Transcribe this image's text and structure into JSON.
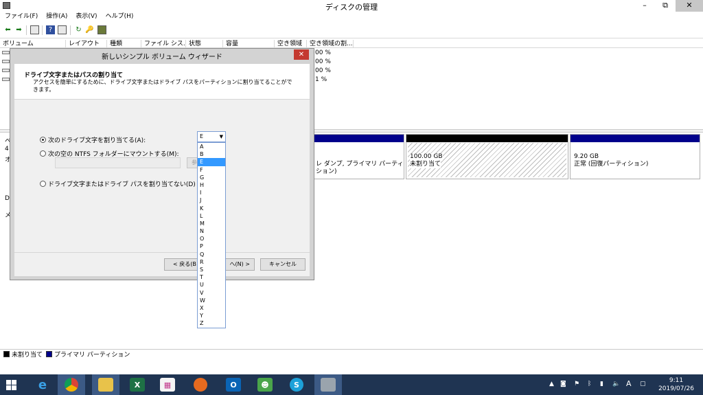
{
  "window": {
    "title": "ディスクの管理",
    "minimize": "–",
    "restore": "⧉",
    "close": "✕"
  },
  "menu": [
    "ファイル(F)",
    "操作(A)",
    "表示(V)",
    "ヘルプ(H)"
  ],
  "toolbar": {
    "icons": [
      "back-arrow-icon",
      "forward-arrow-icon",
      "properties-icon",
      "help-icon",
      "view-icon",
      "refresh-icon",
      "key-icon",
      "disk-icon"
    ]
  },
  "volume_table": {
    "headers": [
      "ボリューム",
      "レイアウト",
      "種類",
      "ファイル シス...",
      "状態",
      "容量",
      "空き領域",
      "空き領域の割..."
    ],
    "visible_cells": [
      "00 %",
      "00 %",
      "00 %",
      "1 %"
    ]
  },
  "disk_panel": {
    "left_labels": [
      "ベ",
      "4",
      "オ",
      "D",
      "メ"
    ],
    "partition_text": "レ ダンプ, プライマリ パーティション)",
    "unallocated": {
      "size": "100.00 GB",
      "status": "未割り当て"
    },
    "recovery": {
      "size": "9.20 GB",
      "status": "正常 (回復パーティション)"
    }
  },
  "legend": [
    {
      "label": "未割り当て",
      "color": "#000000"
    },
    {
      "label": "プライマリ パーティション",
      "color": "#00008b"
    }
  ],
  "dialog": {
    "title": "新しいシンプル ボリューム ウィザード",
    "close": "✕",
    "heading": "ドライブ文字またはパスの割り当て",
    "description": "アクセスを簡単にするために、ドライブ文字またはドライブ パスをパーティションに割り当てることができます。",
    "option1": "次のドライブ文字を割り当てる(A):",
    "option2": "次の空の NTFS フォルダーにマウントする(M):",
    "browse": "参",
    "option3": "ドライブ文字またはドライブ パスを割り当てない(D)",
    "back_button": "< 戻る(B",
    "next_button": "へ(N) >",
    "cancel_button": "キャンセル"
  },
  "drive_select": {
    "value": "E",
    "options": [
      "A",
      "B",
      "E",
      "F",
      "G",
      "H",
      "I",
      "J",
      "K",
      "L",
      "M",
      "N",
      "O",
      "P",
      "Q",
      "R",
      "S",
      "T",
      "U",
      "V",
      "W",
      "X",
      "Y",
      "Z"
    ],
    "selected": "E"
  },
  "taskbar": {
    "apps": [
      "ie-icon",
      "chrome-icon",
      "file-explorer-icon",
      "excel-icon",
      "paint-icon",
      "firefox-icon",
      "outlook-icon",
      "wechat-icon",
      "skype-icon",
      "disk-management-icon"
    ],
    "tray_ime": "A",
    "time": "9:11",
    "date": "2019/07/26"
  }
}
